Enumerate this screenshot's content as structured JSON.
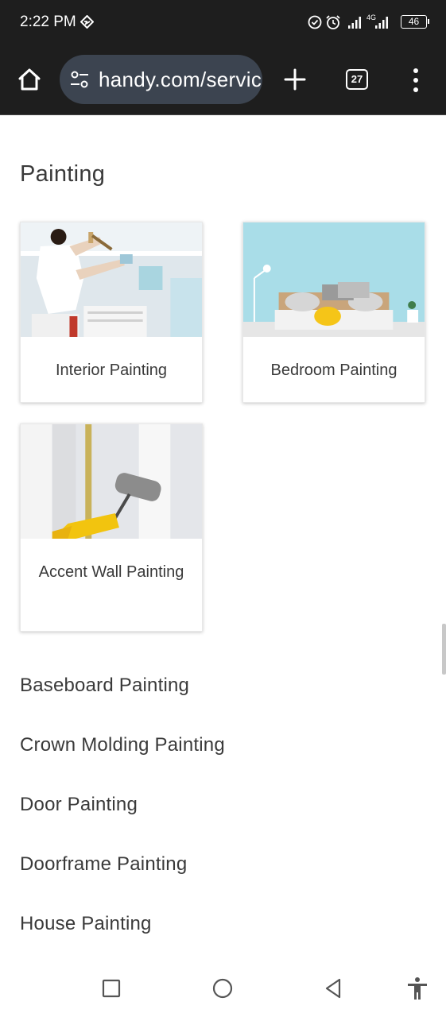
{
  "status_bar": {
    "time": "2:22 PM",
    "battery": "46",
    "network": "4G"
  },
  "browser": {
    "url": "handy.com/servic",
    "tab_count": "27",
    "icons": [
      "home-icon",
      "site-settings-icon",
      "new-tab-icon",
      "tabs-icon",
      "menu-icon"
    ]
  },
  "page": {
    "section_title": "Painting",
    "cards": [
      {
        "label": "Interior Painting",
        "image": "painter-on-ladder-image"
      },
      {
        "label": "Bedroom Painting",
        "image": "blue-bedroom-image"
      },
      {
        "label": "Accent Wall Painting",
        "image": "paint-roller-image"
      }
    ],
    "services": [
      "Baseboard Painting",
      "Crown Molding Painting",
      "Door Painting",
      "Doorframe Painting",
      "House Painting"
    ]
  },
  "nav_bar": {
    "icons": [
      "recents-icon",
      "home-circle-icon",
      "back-icon",
      "accessibility-icon"
    ]
  }
}
